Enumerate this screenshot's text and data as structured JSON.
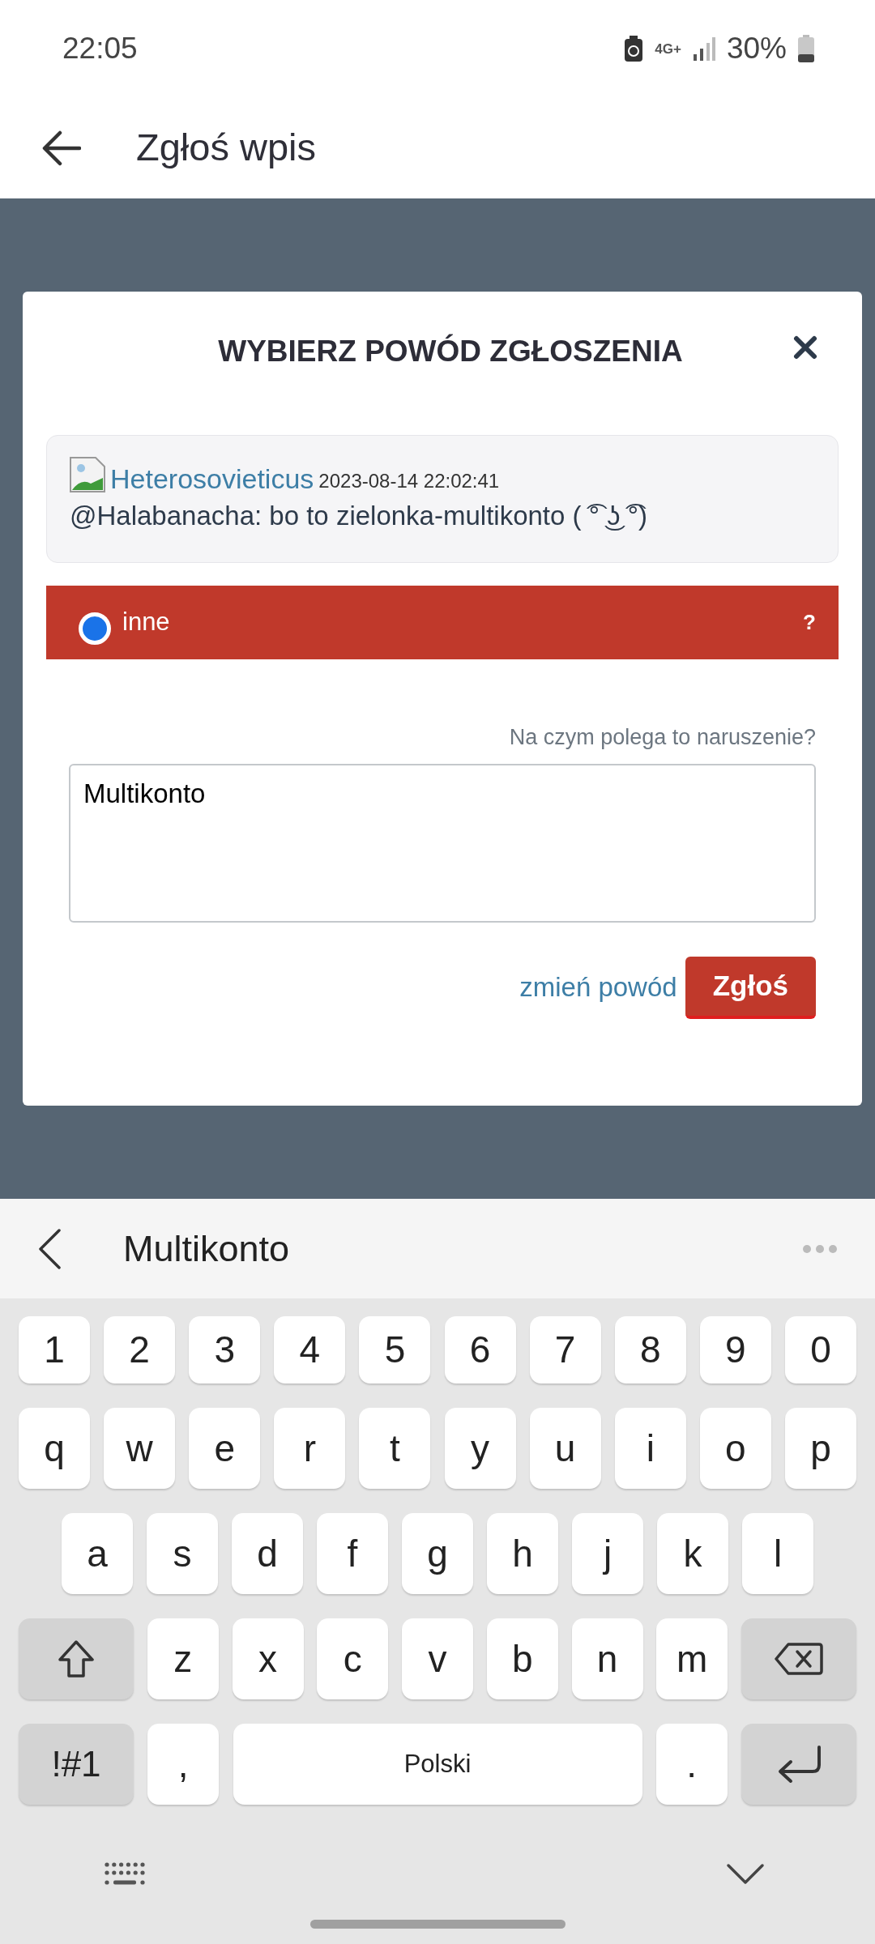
{
  "status_bar": {
    "time": "22:05",
    "network": "4G+",
    "battery": "30%"
  },
  "app_bar": {
    "title": "Zgłoś wpis"
  },
  "dialog": {
    "title": "WYBIERZ POWÓD ZGŁOSZENIA",
    "post": {
      "author": "Heterosovieticus",
      "timestamp": "2023-08-14 22:02:41",
      "text": "@Halabanacha: bo to zielonka-multikonto ( ͡° ͜ʖ ͡°)"
    },
    "reasons": [
      {
        "label": "inne",
        "help": "?",
        "selected": true
      }
    ],
    "field": {
      "label": "Na czym polega to naruszenie?",
      "value": "Multikonto"
    },
    "change_reason": "zmień powód",
    "submit": "Zgłoś"
  },
  "keyboard": {
    "suggestion": "Multikonto",
    "rows": [
      [
        {
          "kind": "char",
          "label": "1"
        },
        {
          "kind": "char",
          "label": "2"
        },
        {
          "kind": "char",
          "label": "3"
        },
        {
          "kind": "char",
          "label": "4"
        },
        {
          "kind": "char",
          "label": "5"
        },
        {
          "kind": "char",
          "label": "6"
        },
        {
          "kind": "char",
          "label": "7"
        },
        {
          "kind": "char",
          "label": "8"
        },
        {
          "kind": "char",
          "label": "9"
        },
        {
          "kind": "char",
          "label": "0"
        }
      ],
      [
        {
          "kind": "char",
          "label": "q"
        },
        {
          "kind": "char",
          "label": "w"
        },
        {
          "kind": "char",
          "label": "e"
        },
        {
          "kind": "char",
          "label": "r"
        },
        {
          "kind": "char",
          "label": "t"
        },
        {
          "kind": "char",
          "label": "y"
        },
        {
          "kind": "char",
          "label": "u"
        },
        {
          "kind": "char",
          "label": "i"
        },
        {
          "kind": "char",
          "label": "o"
        },
        {
          "kind": "char",
          "label": "p"
        }
      ],
      [
        {
          "kind": "char",
          "label": "a"
        },
        {
          "kind": "char",
          "label": "s"
        },
        {
          "kind": "char",
          "label": "d"
        },
        {
          "kind": "char",
          "label": "f"
        },
        {
          "kind": "char",
          "label": "g"
        },
        {
          "kind": "char",
          "label": "h"
        },
        {
          "kind": "char",
          "label": "j"
        },
        {
          "kind": "char",
          "label": "k"
        },
        {
          "kind": "char",
          "label": "l"
        }
      ],
      [
        {
          "kind": "shift"
        },
        {
          "kind": "char",
          "label": "z"
        },
        {
          "kind": "char",
          "label": "x"
        },
        {
          "kind": "char",
          "label": "c"
        },
        {
          "kind": "char",
          "label": "v"
        },
        {
          "kind": "char",
          "label": "b"
        },
        {
          "kind": "char",
          "label": "n"
        },
        {
          "kind": "char",
          "label": "m"
        },
        {
          "kind": "backspace"
        }
      ],
      [
        {
          "kind": "symbols",
          "label": "!#1"
        },
        {
          "kind": "char",
          "label": ","
        },
        {
          "kind": "space",
          "label": "Polski"
        },
        {
          "kind": "char",
          "label": "."
        },
        {
          "kind": "enter"
        }
      ]
    ]
  }
}
